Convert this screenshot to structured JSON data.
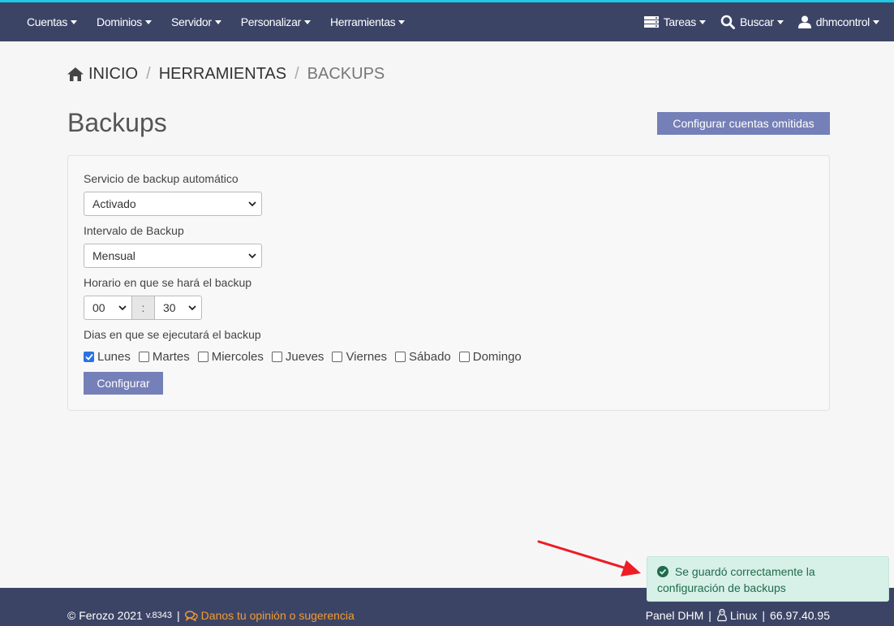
{
  "nav": {
    "left": [
      "Cuentas",
      "Dominios",
      "Servidor",
      "Personalizar",
      "Herramientas"
    ],
    "tareas": "Tareas",
    "buscar": "Buscar",
    "user": "dhmcontrol"
  },
  "breadcrumb": {
    "home": "INICIO",
    "sep": "/",
    "tools": "HERRAMIENTAS",
    "current": "BACKUPS"
  },
  "page": {
    "title": "Backups",
    "omitted_button": "Configurar cuentas omitidas"
  },
  "form": {
    "service_label": "Servicio de backup automático",
    "service_value": "Activado",
    "interval_label": "Intervalo de Backup",
    "interval_value": "Mensual",
    "time_label": "Horario en que se hará el backup",
    "hour_value": "00",
    "time_sep": ":",
    "minute_value": "30",
    "days_label": "Dias en que se ejecutará el backup",
    "days": [
      {
        "label": "Lunes",
        "checked": true
      },
      {
        "label": "Martes",
        "checked": false
      },
      {
        "label": "Miercoles",
        "checked": false
      },
      {
        "label": "Jueves",
        "checked": false
      },
      {
        "label": "Viernes",
        "checked": false
      },
      {
        "label": "Sábado",
        "checked": false
      },
      {
        "label": "Domingo",
        "checked": false
      }
    ],
    "submit": "Configurar"
  },
  "footer": {
    "copyright": "© Ferozo 2021",
    "version": "v.8343",
    "pipe": "|",
    "feedback": "Danos tu opinión o sugerencia",
    "panel": "Panel DHM",
    "os": "Linux",
    "ip": "66.97.40.95"
  },
  "toast": {
    "message": "Se guardó correctamente la configuración de backups"
  },
  "colors": {
    "topbar": "#3c4466",
    "accent": "#1ec8e6",
    "button": "#7580b8",
    "link": "#f39c2f",
    "success_bg": "#d8f1e8",
    "arrow": "#ee1c24"
  }
}
